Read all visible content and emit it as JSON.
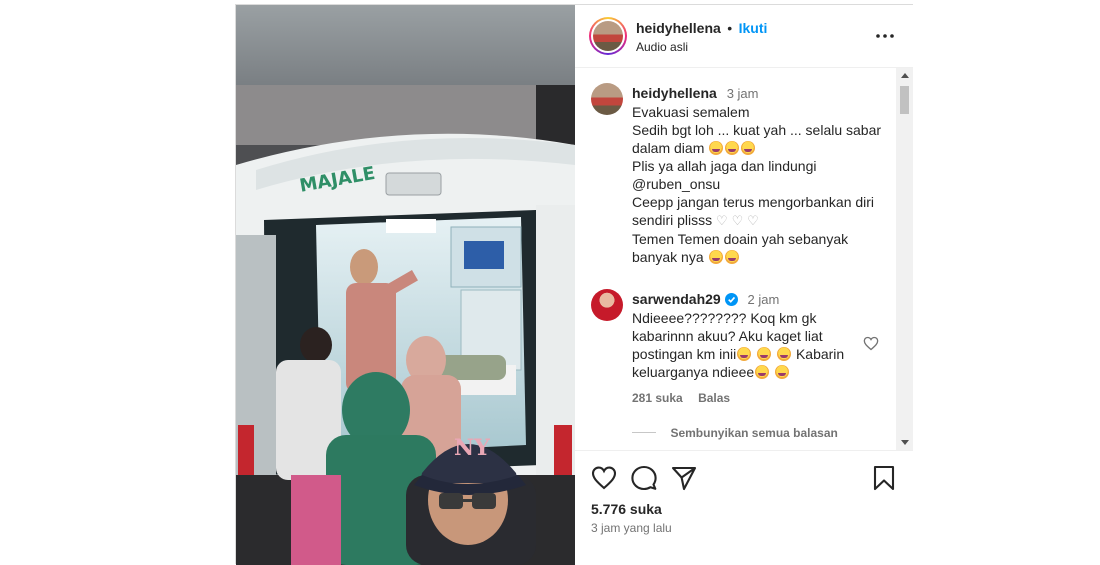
{
  "post": {
    "username": "heidyhellena",
    "separator": "•",
    "follow_label": "Ikuti",
    "audio": "Audio asli",
    "more_icon": "more-horizontal-icon"
  },
  "comments": [
    {
      "username": "heidyhellena",
      "time": "3 jam",
      "lines": {
        "l1": "Evakuasi semalem",
        "l2": "Sedih bgt loh ... kuat yah ... selalu sabar",
        "l3": "dalam diam",
        "l4": "Plis ya allah jaga dan lindungi",
        "mention": "@ruben_onsu",
        "l5": "Ceepp jangan terus mengorbankan diri",
        "l6": "sendiri plisss",
        "l7": "Temen Temen doain yah sebanyak",
        "l8": "banyak nya"
      }
    },
    {
      "username": "sarwendah29",
      "verified": true,
      "time": "2 jam",
      "lines": {
        "l1": "Ndieeee???????? Koq km gk",
        "l2": "kabarinnn akuu? Aku kaget liat",
        "l3": "postingan km inii",
        "l3b": "Kabarin",
        "l4": "keluarganya ndieee"
      },
      "likes": "281 suka",
      "reply": "Balas",
      "hide_replies": "Sembunyikan semua balasan"
    }
  ],
  "footer": {
    "likes": "5.776 suka",
    "posted": "3 jam yang lalu"
  },
  "media": {
    "vehicle_text": "MAJALE",
    "cap_logo": "NY"
  },
  "colors": {
    "link": "#0095f6",
    "mention": "#00376b",
    "verified": "#0095f6"
  }
}
